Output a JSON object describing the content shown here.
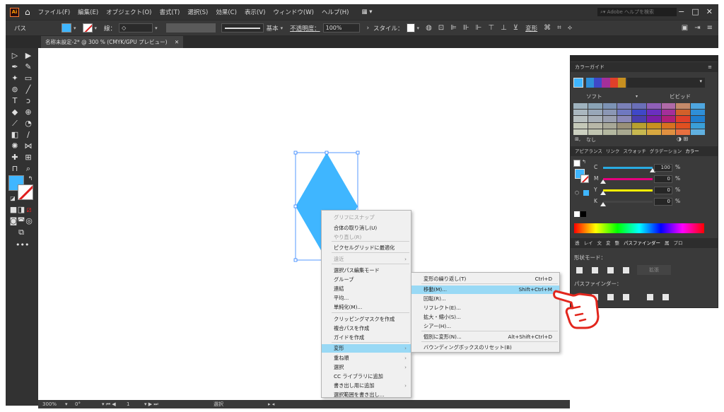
{
  "app": {
    "logo": "Ai",
    "menu": [
      "ファイル(F)",
      "編集(E)",
      "オブジェクト(O)",
      "書式(T)",
      "選択(S)",
      "効果(C)",
      "表示(V)",
      "ウィンドウ(W)",
      "ヘルプ(H)"
    ],
    "help_search_placeholder": "Adobe ヘルプを検索",
    "window_buttons": [
      "−",
      "□",
      "✕"
    ]
  },
  "control_bar": {
    "selection_label": "パス",
    "stroke_label": "線：",
    "stroke_style": "基本",
    "opacity_label": "不透明度：",
    "opacity_value": "100%",
    "style_label": "スタイル：",
    "transform_label": "変形"
  },
  "document_tab": {
    "title": "名称未設定-2* @ 300 % (CMYK/GPU プレビュー)",
    "close": "✕"
  },
  "status_bar": {
    "zoom": "300%",
    "rotation": "0°",
    "artboard": "1",
    "mode": "選択"
  },
  "context_menu": {
    "items": [
      {
        "label": "グリフにスナップ",
        "disabled": true
      },
      {
        "label": "合体の取り消し(U)",
        "disabled": false
      },
      {
        "label": "やり直し(R)",
        "disabled": true
      },
      {
        "label": "ピクセルグリッドに最適化",
        "disabled": false
      },
      {
        "label": "遠近",
        "disabled": true,
        "submenu": true
      },
      {
        "label": "選択パス編集モード",
        "disabled": false
      },
      {
        "label": "グループ",
        "disabled": false
      },
      {
        "label": "連結",
        "disabled": false
      },
      {
        "label": "平均...",
        "disabled": false
      },
      {
        "label": "単純化(M)...",
        "disabled": false
      },
      {
        "label": "クリッピングマスクを作成",
        "disabled": false
      },
      {
        "label": "複合パスを作成",
        "disabled": false
      },
      {
        "label": "ガイドを作成",
        "disabled": false
      },
      {
        "label": "変形",
        "disabled": false,
        "submenu": true,
        "highlighted": true
      },
      {
        "label": "重ね順",
        "disabled": false,
        "submenu": true
      },
      {
        "label": "選択",
        "disabled": false,
        "submenu": true
      },
      {
        "label": "CC ライブラリに追加",
        "disabled": false
      },
      {
        "label": "書き出し用に追加",
        "disabled": false,
        "submenu": true
      },
      {
        "label": "選択範囲を書き出し...",
        "disabled": false
      }
    ]
  },
  "submenu": {
    "items": [
      {
        "label": "変形の繰り返し(T)",
        "shortcut": "Ctrl+D"
      },
      {
        "label": "移動(M)...",
        "shortcut": "Shift+Ctrl+M",
        "highlighted": true
      },
      {
        "label": "回転(R)...",
        "shortcut": ""
      },
      {
        "label": "リフレクト(E)...",
        "shortcut": ""
      },
      {
        "label": "拡大・縮小(S)...",
        "shortcut": ""
      },
      {
        "label": "シアー(H)...",
        "shortcut": ""
      },
      {
        "label": "個別に変形(N)...",
        "shortcut": "Alt+Shift+Ctrl+D"
      },
      {
        "label": "バウンディングボックスのリセット(B)",
        "shortcut": ""
      }
    ]
  },
  "color_guide": {
    "title": "カラーガイド",
    "soft_label": "ソフト",
    "vivid_label": "ビビッド",
    "none_label": "なし",
    "swatches": [
      [
        "#9fb3bf",
        "#8aa3b6",
        "#7c93b5",
        "#7a80b8",
        "#6a6fb8",
        "#8f5fb8",
        "#b06aa8",
        "#c58a6a",
        "#4ea6e0"
      ],
      [
        "#aab7bf",
        "#98a7b8",
        "#8b97b5",
        "#6f78c0",
        "#3f48c8",
        "#6a2fc0",
        "#a42f9a",
        "#d2602a",
        "#2f8fd8"
      ],
      [
        "#b8c0c0",
        "#a8b0b8",
        "#9aa0b0",
        "#8a88b8",
        "#4a3fb0",
        "#7a1fa8",
        "#b01f7a",
        "#e0402a",
        "#1f7fd0"
      ],
      [
        "#c4c8b8",
        "#b8b8a8",
        "#a8a898",
        "#9a9078",
        "#b8a030",
        "#c89020",
        "#d87020",
        "#e05020",
        "#3a9fd8"
      ],
      [
        "#ccd0c0",
        "#c0c4b0",
        "#b4b8a0",
        "#a8a890",
        "#c8b850",
        "#d8a840",
        "#e09040",
        "#e87040",
        "#60b0e0"
      ]
    ]
  },
  "color_panel": {
    "tabs": [
      "アピアランス",
      "リンク",
      "スウォッチ",
      "グラデーション",
      "カラー"
    ],
    "channels": [
      {
        "name": "C",
        "value": "100",
        "unit": "%",
        "fraction": 1.0,
        "color": "#29abe2"
      },
      {
        "name": "M",
        "value": "0",
        "unit": "%",
        "fraction": 0.0,
        "color": "#e6007e"
      },
      {
        "name": "Y",
        "value": "0",
        "unit": "%",
        "fraction": 0.0,
        "color": "#fff100"
      },
      {
        "name": "K",
        "value": "0",
        "unit": "%",
        "fraction": 0.0,
        "color": "#444444"
      }
    ]
  },
  "pathfinder": {
    "tabs": [
      "透",
      "レイ",
      "文",
      "変",
      "整",
      "パスファインダー",
      "属",
      "プロ"
    ],
    "shape_modes_label": "形状モード：",
    "expand_label": "拡張",
    "pathfinders_label": "パスファインダー："
  },
  "colors": {
    "fill": "#3fb6ff",
    "highlight": "#99d9f5",
    "hand_stroke": "#e2261d"
  }
}
